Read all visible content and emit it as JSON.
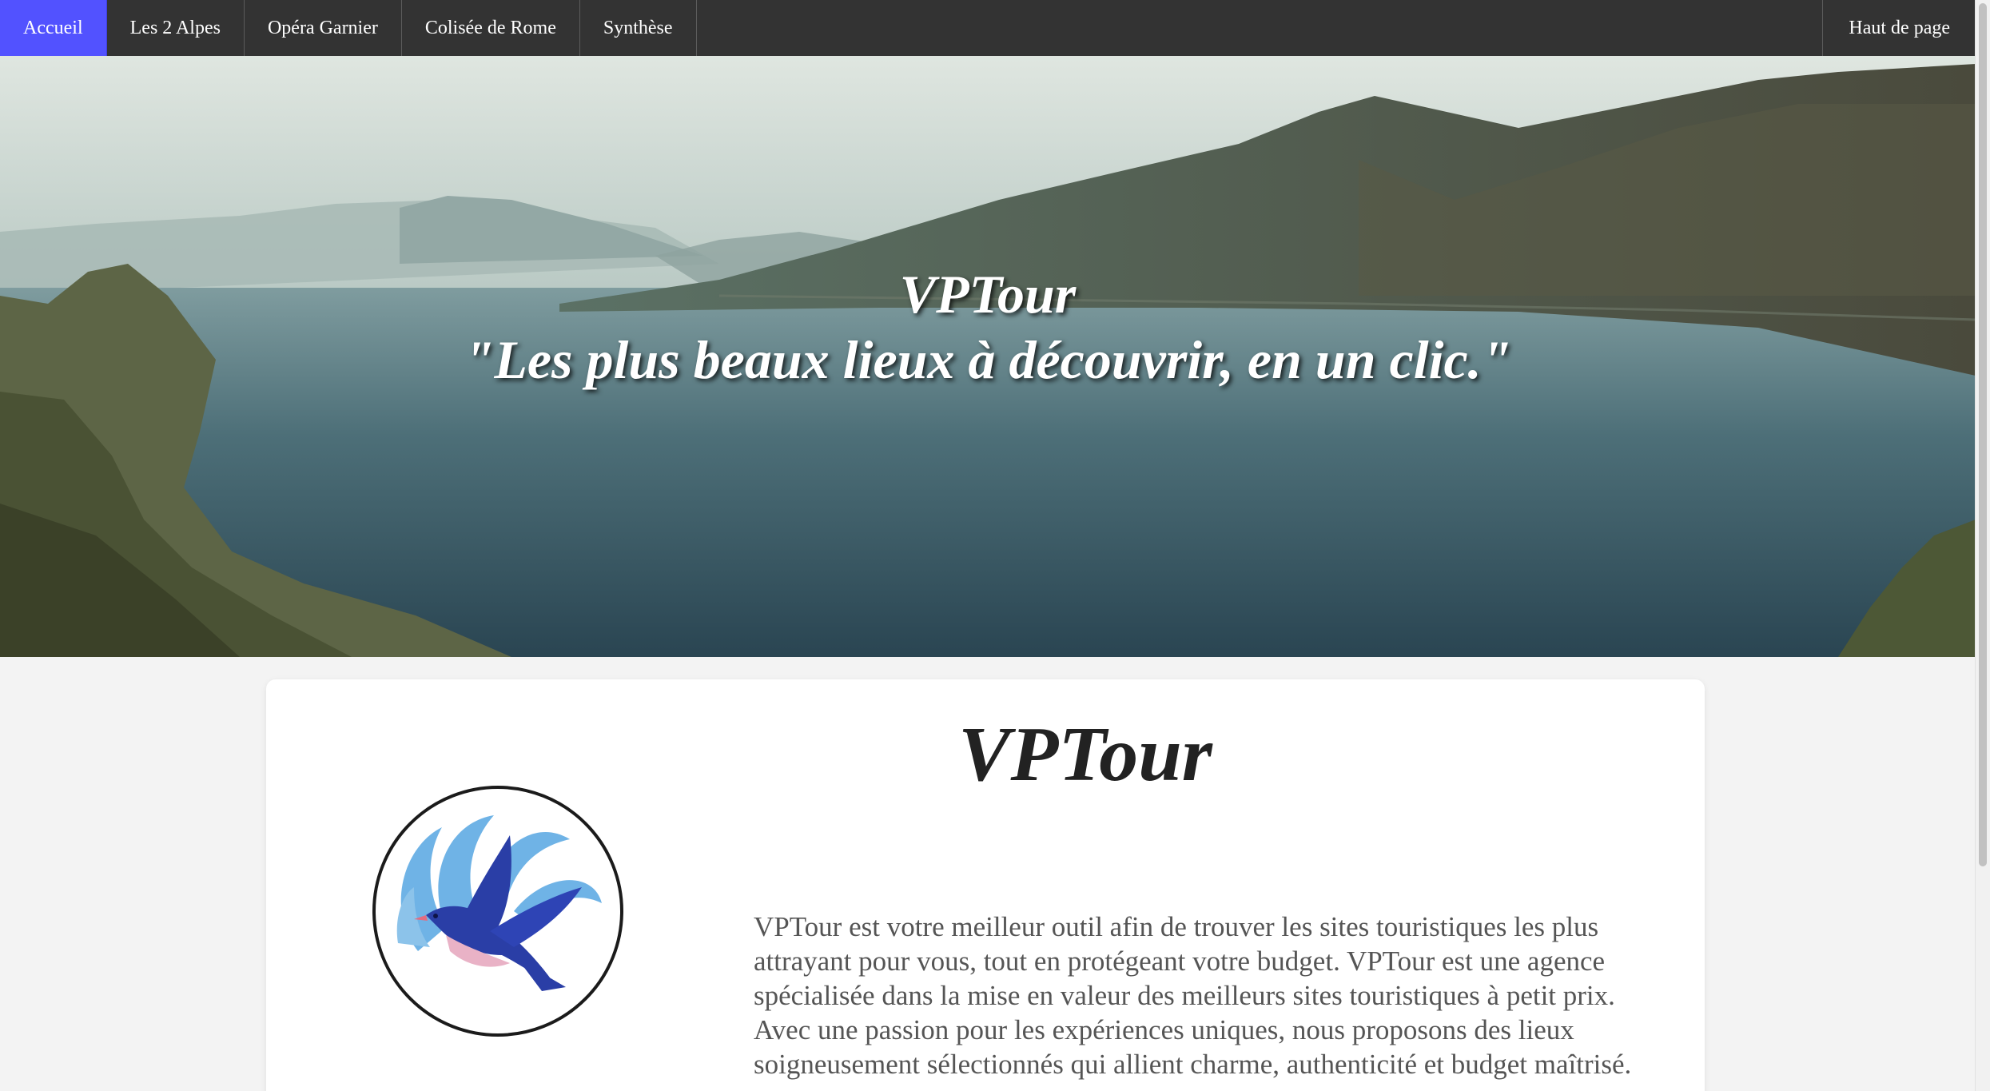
{
  "nav": {
    "items": [
      {
        "label": "Accueil",
        "active": true
      },
      {
        "label": "Les 2 Alpes",
        "active": false
      },
      {
        "label": "Opéra Garnier",
        "active": false
      },
      {
        "label": "Colisée de Rome",
        "active": false
      },
      {
        "label": "Synthèse",
        "active": false
      }
    ],
    "right_label": "Haut de page",
    "active_color": "#5252ff",
    "background_color": "#333333"
  },
  "hero": {
    "title": "VPTour",
    "tagline": "\"Les plus beaux lieux à découvrir, en un clic.\"",
    "image": "lake-and-mountains-landscape"
  },
  "intro": {
    "title": "VPTour",
    "logo": "bird-logo-icon",
    "paragraph": "VPTour est votre meilleur outil afin de trouver les sites touristiques les plus attrayant pour vous, tout en protégeant votre budget. VPTour est une agence spécialisée dans la mise en valeur des meilleurs sites touristiques à petit prix. Avec une passion pour les expériences uniques, nous proposons des lieux soigneusement sélectionnés qui allient charme, authenticité et budget maîtrisé."
  }
}
